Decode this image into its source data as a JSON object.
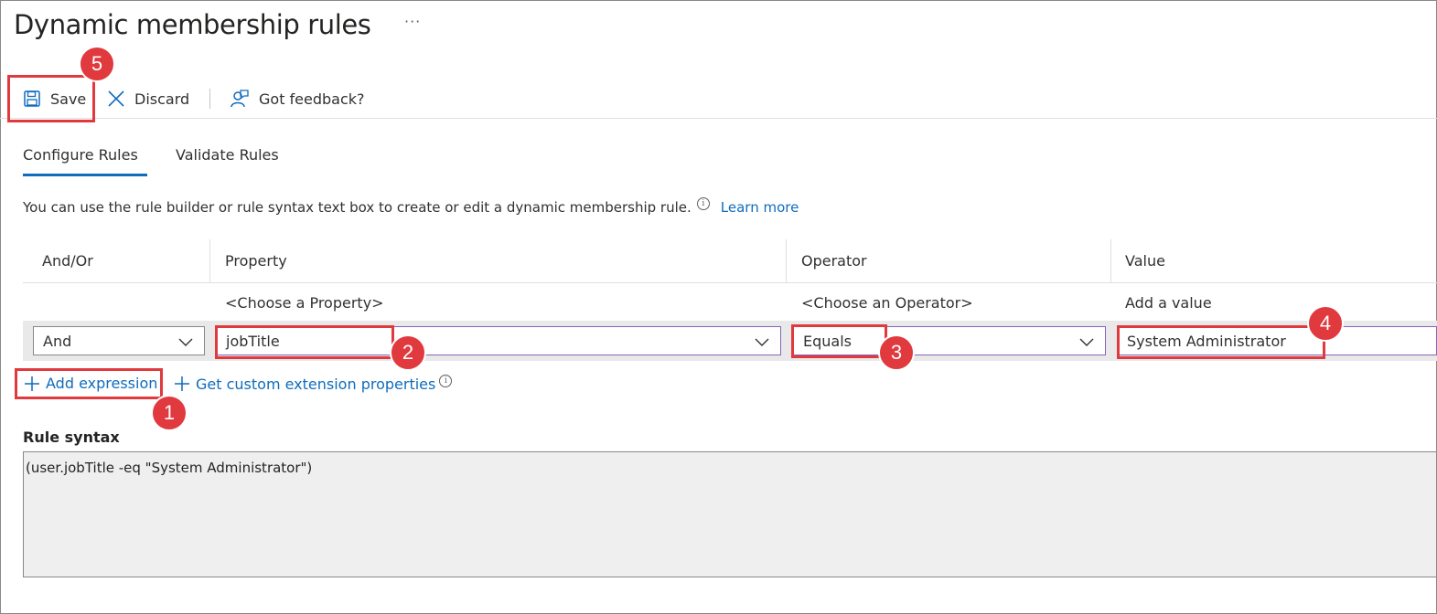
{
  "page": {
    "title": "Dynamic membership rules",
    "more": "···"
  },
  "toolbar": {
    "save": "Save",
    "discard": "Discard",
    "feedback": "Got feedback?"
  },
  "tabs": [
    {
      "label": "Configure Rules",
      "active": true
    },
    {
      "label": "Validate Rules",
      "active": false
    }
  ],
  "intro": {
    "text": "You can use the rule builder or rule syntax text box to create or edit a dynamic membership rule.",
    "learn_more": "Learn more"
  },
  "rule_builder": {
    "columns": [
      "And/Or",
      "Property",
      "Operator",
      "Value"
    ],
    "placeholders": {
      "property": "<Choose a Property>",
      "operator": "<Choose an Operator>",
      "value": "Add a value"
    },
    "row": {
      "and_or": "And",
      "property": "jobTitle",
      "operator": "Equals",
      "value": "System Administrator"
    },
    "add_expression": "Add expression",
    "custom_ext": "Get custom extension properties"
  },
  "rule_syntax": {
    "label": "Rule syntax",
    "value": "(user.jobTitle -eq \"System Administrator\")"
  },
  "callouts": [
    "1",
    "2",
    "3",
    "4",
    "5"
  ],
  "colors": {
    "accent": "#0f6cbd",
    "callout": "#e0393e",
    "row_bg": "#e9e9e9"
  },
  "icons": [
    "save-icon",
    "discard-icon",
    "feedback-icon",
    "info-icon",
    "chevron-down-icon",
    "plus-icon"
  ]
}
